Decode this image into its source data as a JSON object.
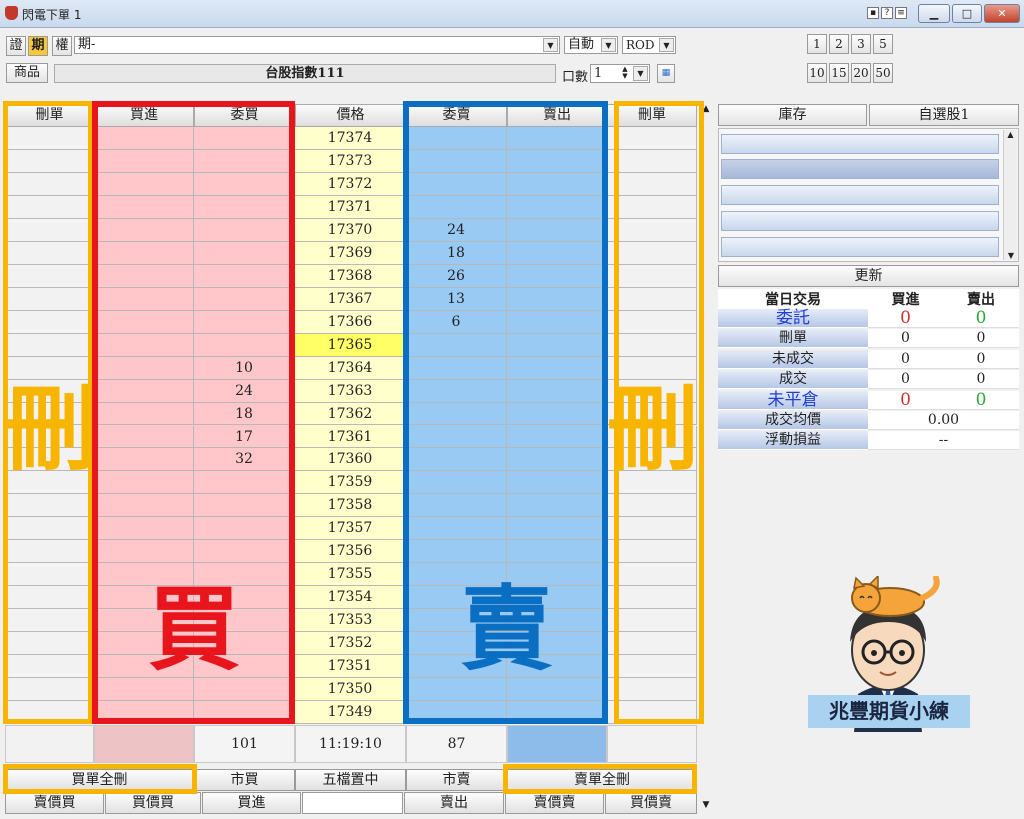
{
  "window": {
    "title": "閃電下單 1"
  },
  "toolbar": {
    "type_tabs": [
      "證",
      "期",
      "權"
    ],
    "account_value": "期-",
    "mode_select": "自動",
    "order_type_select": "ROD",
    "product_button": "商品",
    "product_name": "台股指數111",
    "qty_label": "口數",
    "qty_value": "1",
    "quick_qty_row1": [
      "1",
      "2",
      "3",
      "5"
    ],
    "quick_qty_row2": [
      "10",
      "15",
      "20",
      "50"
    ]
  },
  "ladder": {
    "headers": [
      "刪單",
      "買進",
      "委買",
      "價格",
      "委賣",
      "賣出",
      "刪單"
    ],
    "prices": [
      "17374",
      "17373",
      "17372",
      "17371",
      "17370",
      "17369",
      "17368",
      "17367",
      "17366",
      "17365",
      "17364",
      "17363",
      "17362",
      "17361",
      "17360",
      "17359",
      "17358",
      "17357",
      "17356",
      "17355",
      "17354",
      "17353",
      "17352",
      "17351",
      "17350",
      "17349"
    ],
    "current_price": "17365",
    "bid_qty": [
      "",
      "",
      "",
      "",
      "",
      "",
      "",
      "",
      "",
      "",
      "10",
      "24",
      "18",
      "17",
      "32",
      "",
      "",
      "",
      "",
      "",
      "",
      "",
      "",
      "",
      "",
      ""
    ],
    "ask_qty": [
      "",
      "",
      "",
      "",
      "24",
      "18",
      "26",
      "13",
      "6",
      "",
      "",
      "",
      "",
      "",
      "",
      "",
      "",
      "",
      "",
      "",
      "",
      "",
      "",
      "",
      "",
      ""
    ],
    "annotation_delete": "刪",
    "annotation_buy": "買",
    "annotation_sell": "賣"
  },
  "summary_row": {
    "bid_total": "101",
    "time": "11:19:10",
    "ask_total": "87"
  },
  "bottom_buttons": {
    "buy_delete_all": "買單全刪",
    "market_buy": "市買",
    "center": "五檔置中",
    "market_sell": "市賣",
    "sell_delete_all": "賣單全刪"
  },
  "bottom_row2": [
    "賣價買",
    "買價買",
    "買進",
    "",
    "賣出",
    "賣價賣",
    "買價賣"
  ],
  "right_panel": {
    "tabs": [
      "庫存",
      "自選股1"
    ],
    "refresh": "更新",
    "table_headers": [
      "當日交易",
      "買進",
      "賣出"
    ],
    "rows": [
      {
        "label": "委託",
        "buy": "0",
        "sell": "0",
        "highlight": true
      },
      {
        "label": "刪單",
        "buy": "0",
        "sell": "0",
        "highlight": false
      },
      {
        "label": "未成交",
        "buy": "0",
        "sell": "0",
        "highlight": false
      },
      {
        "label": "成交",
        "buy": "0",
        "sell": "0",
        "highlight": false
      },
      {
        "label": "未平倉",
        "buy": "0",
        "sell": "0",
        "highlight": true
      }
    ],
    "avg_price_label": "成交均價",
    "avg_price_value": "0.00",
    "pnl_label": "浮動損益",
    "pnl_value": "--"
  },
  "logo": {
    "text": "兆豐期貨小練"
  },
  "colors": {
    "buy_bg": "#ffc7c9",
    "sell_bg": "#99caf4",
    "price_bg": "#ffffcc",
    "current_price_bg": "#ffff66",
    "buy_frame": "#e8161c",
    "sell_frame": "#0a6fc2",
    "delete_frame": "#f7b500"
  }
}
